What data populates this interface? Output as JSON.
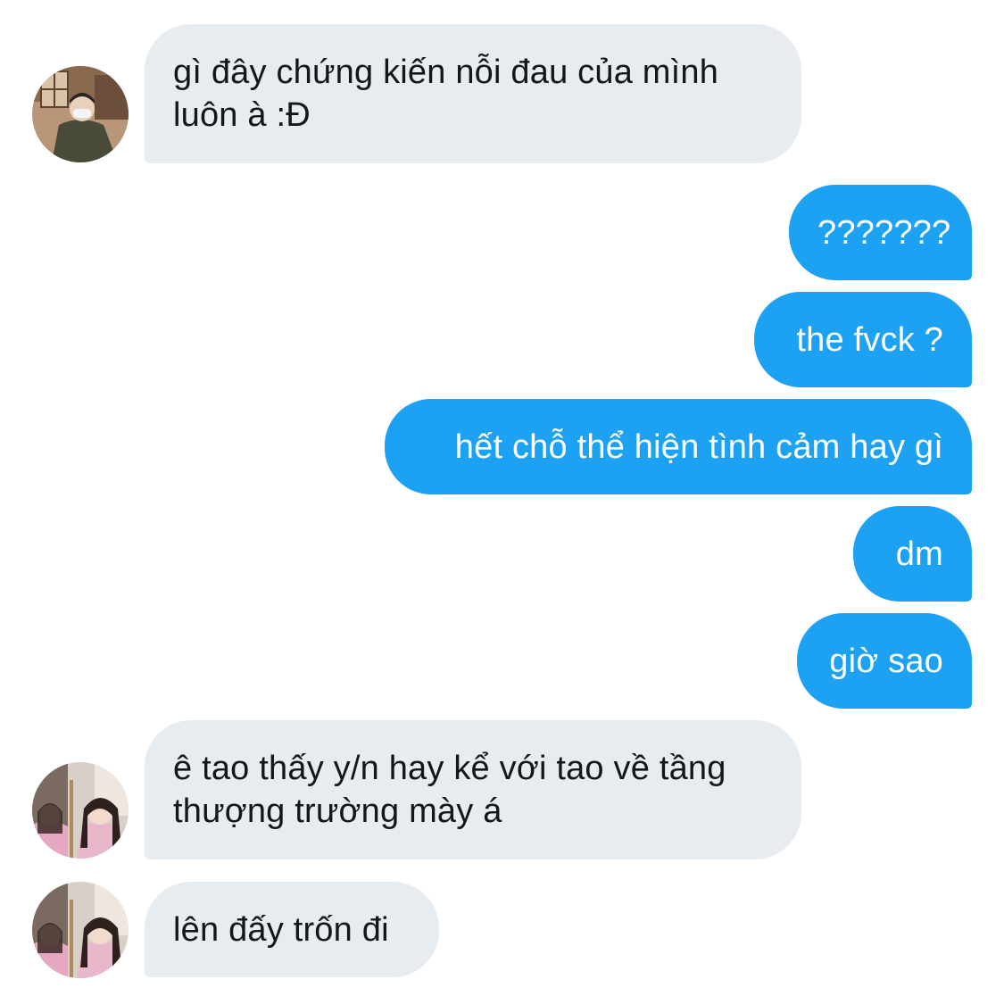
{
  "conversation": {
    "messages": [
      {
        "direction": "incoming",
        "text": "gì đây chứng kiến nỗi đau của mình\nluôn à :Đ",
        "avatar": "avatar-man-masked"
      },
      {
        "direction": "outgoing",
        "text": "???????"
      },
      {
        "direction": "outgoing",
        "text": "the fvck ?"
      },
      {
        "direction": "outgoing",
        "text": "hết chỗ thể hiện tình cảm hay gì"
      },
      {
        "direction": "outgoing",
        "text": "dm"
      },
      {
        "direction": "outgoing",
        "text": "giờ sao"
      },
      {
        "direction": "incoming",
        "text": "ê tao thấy y/n hay kể với tao về tầng\nthượng trường mày á",
        "avatar": "avatar-girl-pink"
      },
      {
        "direction": "incoming",
        "text": "lên đấy trốn đi",
        "avatar": "avatar-girl-pink"
      }
    ]
  },
  "colors": {
    "incoming_bubble": "#e6ecf0",
    "outgoing_bubble": "#1da1f2",
    "incoming_text": "#14171a",
    "outgoing_text": "#ffffff"
  }
}
